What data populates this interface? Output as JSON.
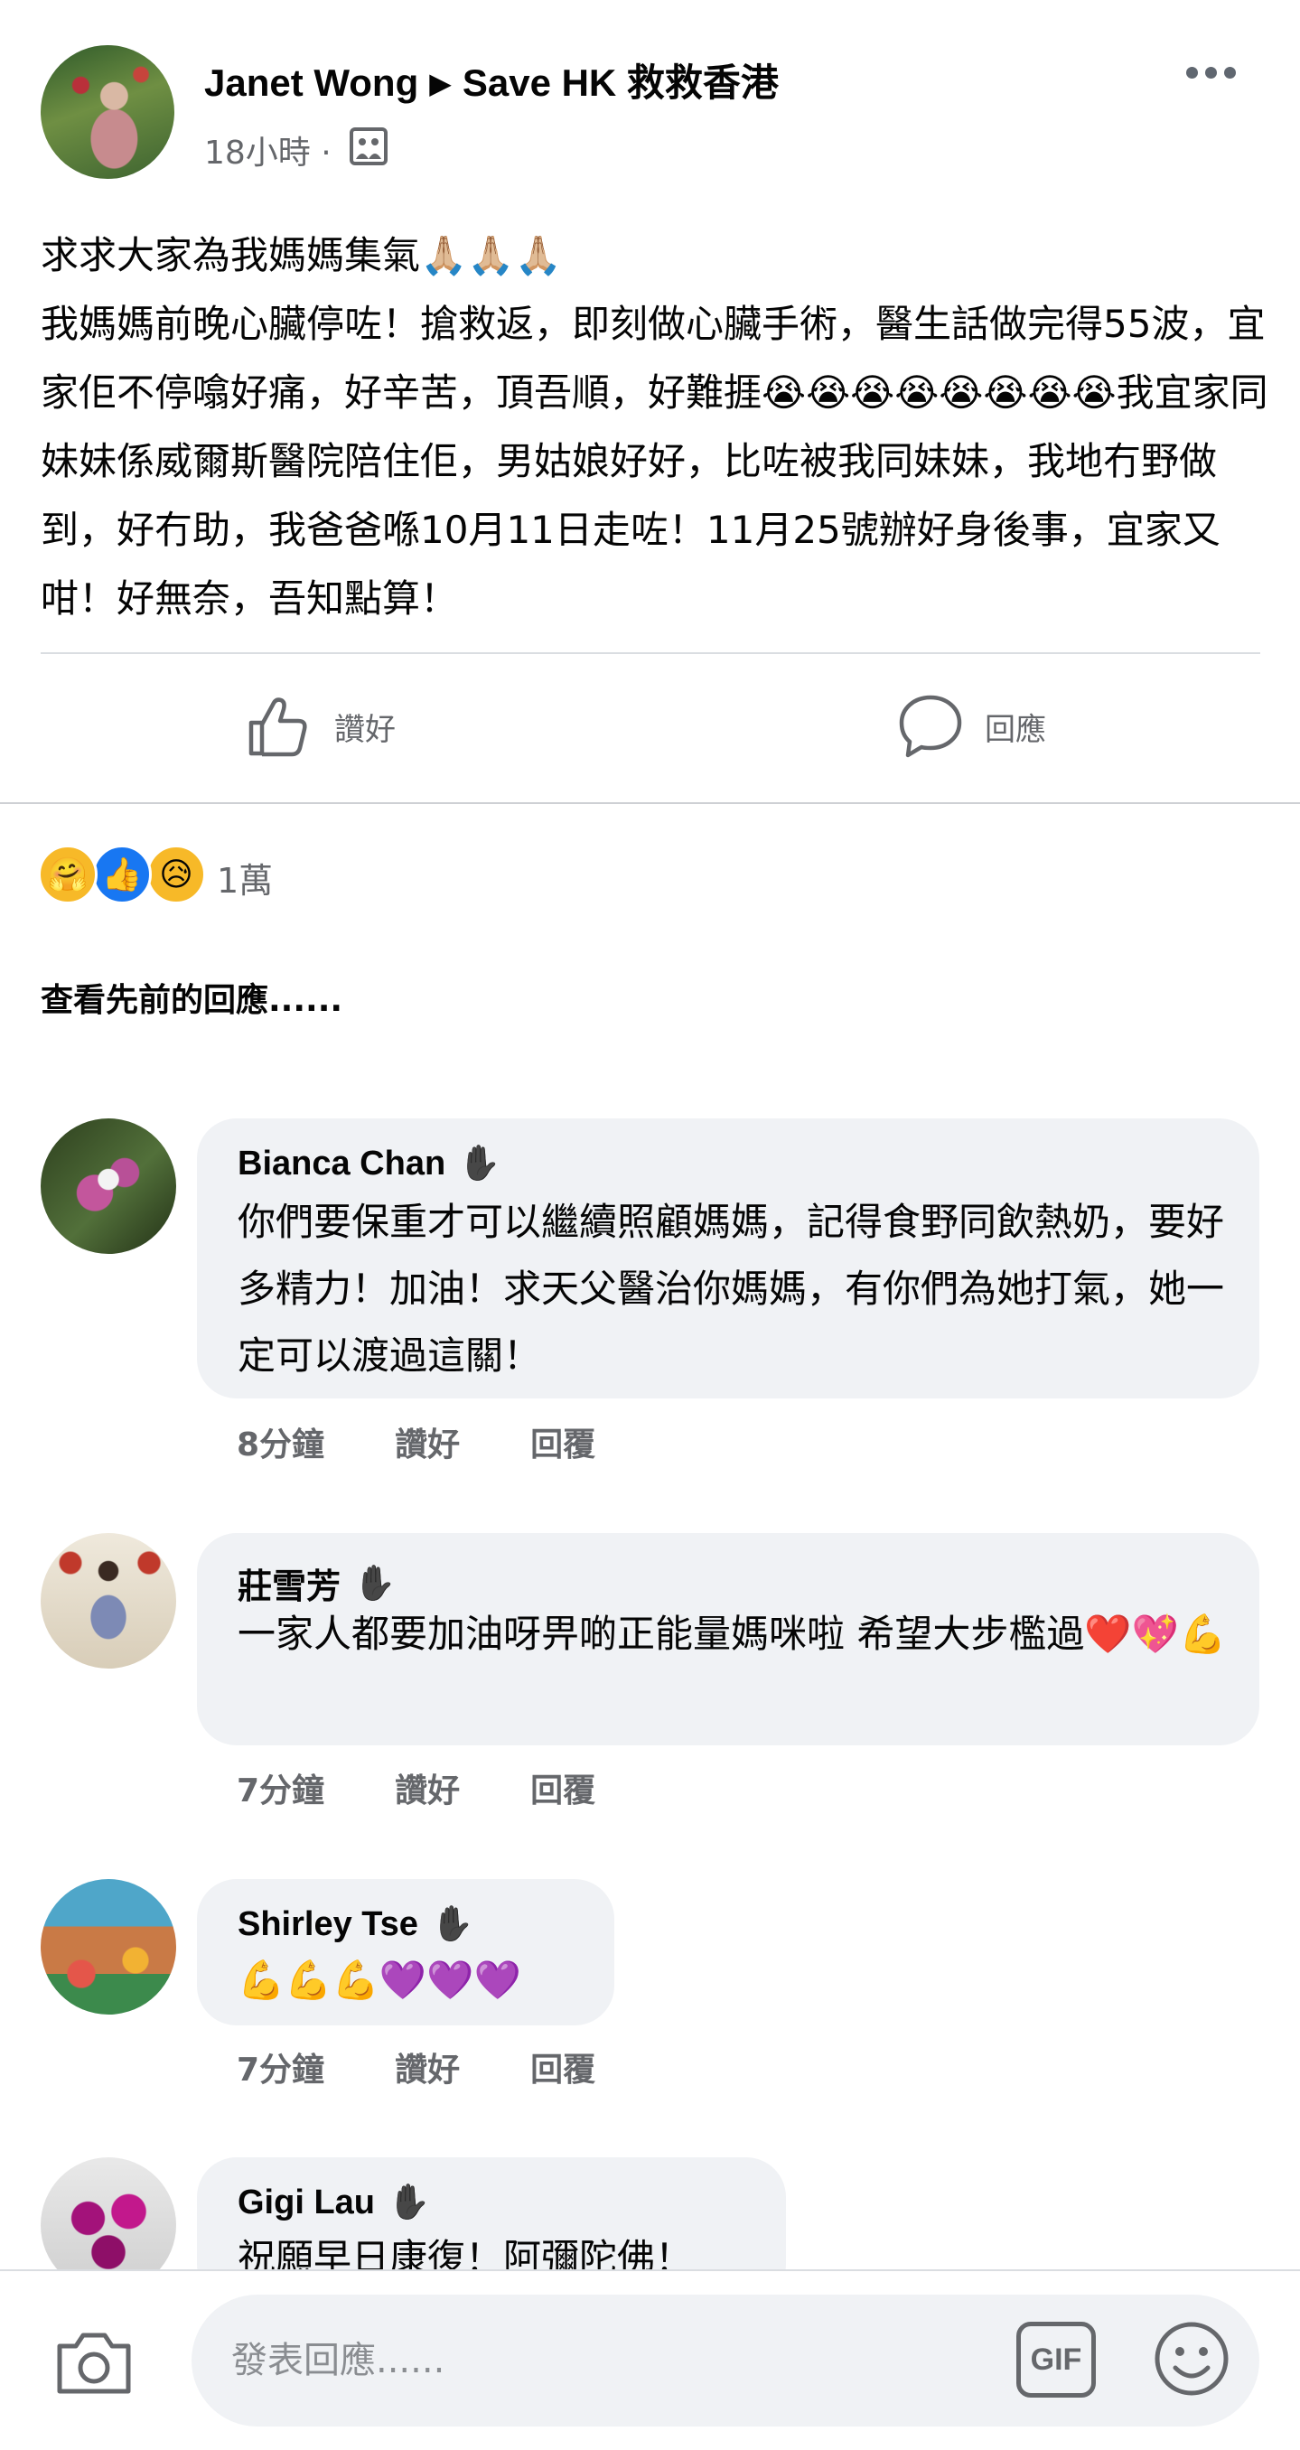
{
  "post": {
    "author": "Janet Wong",
    "group": "Save HK 救救香港",
    "time": "18小時",
    "separator": "·",
    "lines": [
      "求求大家為我媽媽集氣🙏🏼🙏🏼🙏🏼",
      "我媽媽前晚心臟停咗！搶救返，即刻做心臟手術，醫生話做完得55波，宜家佢不停噏好痛，好辛苦，頂吾順，好難捱😭😭😭😭😭😭😭😭我宜家同妹妹係威爾斯醫院陪住佢，男姑娘好好，比咗被我同妹妹，我地冇野做到，好冇助，我爸爸喺10月11日走咗！11月25號辦好身後事，宜家又咁！好無奈，吾知點算！"
    ]
  },
  "actions": {
    "like_label": "讚好",
    "comment_label": "回應"
  },
  "reactions": {
    "emojis": [
      "🤗",
      "👍",
      "😥"
    ],
    "count": "1萬"
  },
  "view_previous": "查看先前的回應......",
  "comments": [
    {
      "name": "Bianca Chan",
      "text": "你們要保重才可以繼續照顧媽媽，記得食野同飲熱奶，要好多精力！加油！求天父醫治你媽媽，有你們為她打氣，她一定可以渡過這關！",
      "time": "8分鐘",
      "like": "讚好",
      "reply": "回覆"
    },
    {
      "name": "莊雪芳",
      "text": "一家人都要加油呀畀啲正能量媽咪啦 希望大步檻過❤️💖💪",
      "time": "7分鐘",
      "like": "讚好",
      "reply": "回覆"
    },
    {
      "name": "Shirley Tse",
      "text": "💪💪💪💜💜💜",
      "time": "7分鐘",
      "like": "讚好",
      "reply": "回覆"
    },
    {
      "name": "Gigi Lau",
      "text": "祝願早日康復！阿彌陀佛！"
    }
  ],
  "composer": {
    "placeholder": "發表回應......",
    "gif_label": "GIF"
  },
  "icons": {
    "wave": "✋"
  },
  "colors": {
    "bubble": "#f0f2f5",
    "secondary_text": "#65676b",
    "like_blue": "#1877f2"
  }
}
